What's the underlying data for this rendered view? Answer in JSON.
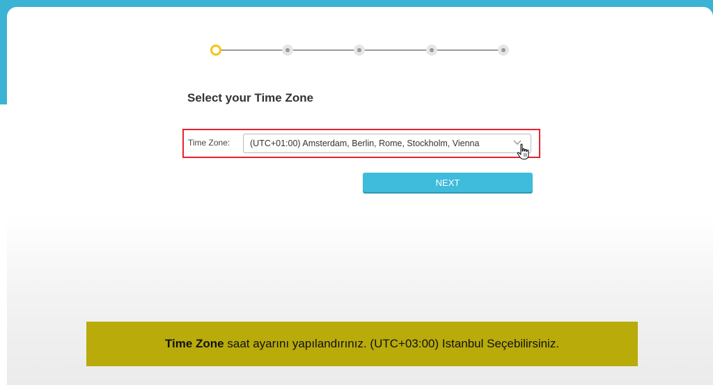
{
  "wizard": {
    "steps": [
      {
        "state": "active"
      },
      {
        "state": "pending"
      },
      {
        "state": "pending"
      },
      {
        "state": "pending"
      },
      {
        "state": "pending"
      }
    ],
    "current_step": 1,
    "title": "Select your Time Zone"
  },
  "timezone": {
    "label": "Time Zone:",
    "selected": "(UTC+01:00) Amsterdam, Berlin, Rome, Stockholm, Vienna"
  },
  "actions": {
    "next_label": "NEXT"
  },
  "caption": {
    "bold": "Time Zone",
    "rest": " saat ayarını yapılandırınız. (UTC+03:00) Istanbul Seçebilirsiniz."
  },
  "colors": {
    "accent": "#3fbbdc",
    "active_step": "#f5c518",
    "highlight_border": "#e8212b",
    "caption_bg": "#b8ab0a"
  },
  "icons": {
    "dropdown": "chevron-down-icon",
    "cursor": "hand-pointer-icon"
  }
}
